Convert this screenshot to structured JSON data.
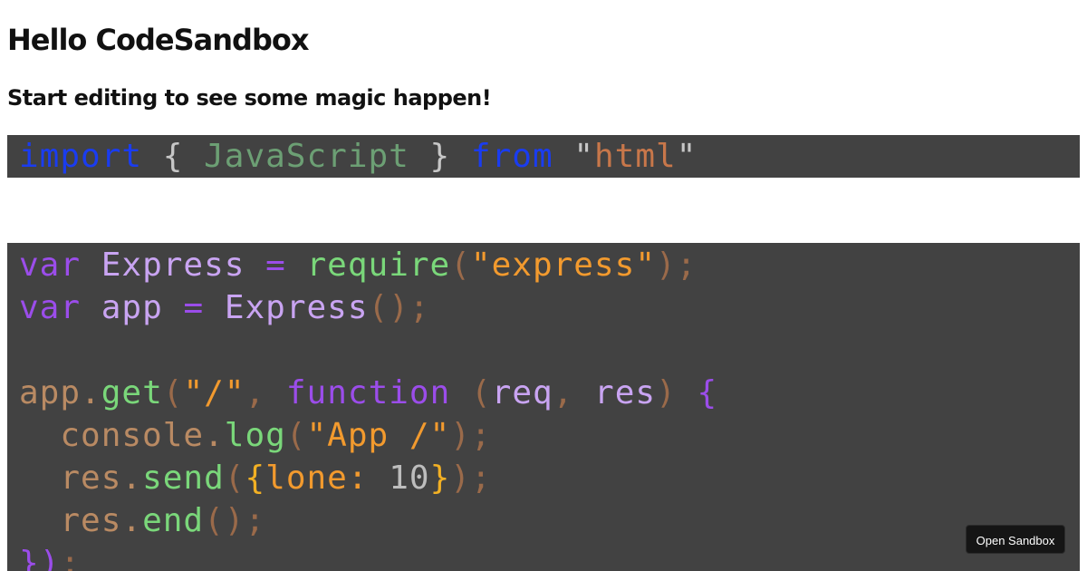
{
  "header": {
    "title": "Hello CodeSandbox",
    "subtitle": "Start editing to see some magic happen!"
  },
  "code_top": {
    "tokens": [
      "import",
      "{",
      "JavaScript",
      "}",
      "from",
      "\"",
      "html",
      "\""
    ]
  },
  "code_main": {
    "line1": [
      "var",
      "Express",
      "=",
      "require",
      "(",
      "\"",
      "express",
      "\"",
      ")",
      ";"
    ],
    "line2": [
      "var",
      "app",
      "=",
      "Express",
      "(",
      ")",
      ";"
    ],
    "line4": [
      "app",
      ".",
      "get",
      "(",
      "\"",
      "/",
      "\"",
      ",",
      "function",
      "(",
      "req",
      ",",
      "res",
      ")",
      "{"
    ],
    "line5": [
      "console",
      ".",
      "log",
      "(",
      "\"",
      "App /",
      "\"",
      ")",
      ";"
    ],
    "line6": [
      "res",
      ".",
      "send",
      "(",
      "{",
      "lone",
      ":",
      "10",
      "}",
      ")",
      ";"
    ],
    "line7": [
      "res",
      ".",
      "end",
      "(",
      ")",
      ";"
    ],
    "line8": [
      "}",
      ")",
      ";"
    ]
  },
  "actions": {
    "open_sandbox_label": "Open Sandbox"
  }
}
